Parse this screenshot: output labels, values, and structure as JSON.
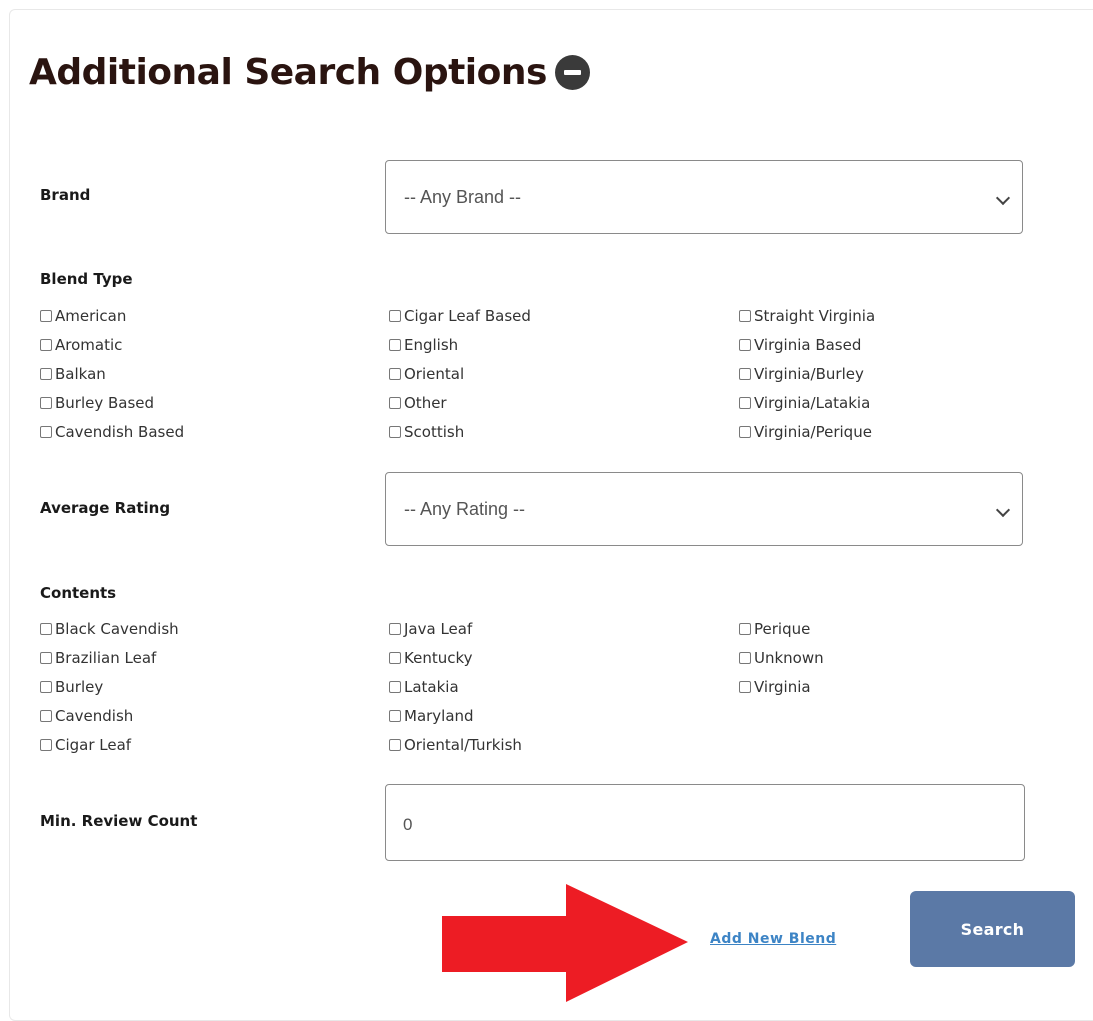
{
  "header": {
    "title": "Additional Search Options",
    "toggle_icon": "minus-circle-icon"
  },
  "brand": {
    "label": "Brand",
    "selected": "-- Any Brand --"
  },
  "blend_type": {
    "label": "Blend Type",
    "columns": [
      [
        "American",
        "Aromatic",
        "Balkan",
        "Burley Based",
        "Cavendish Based"
      ],
      [
        "Cigar Leaf Based",
        "English",
        "Oriental",
        "Other",
        "Scottish"
      ],
      [
        "Straight Virginia",
        "Virginia Based",
        "Virginia/Burley",
        "Virginia/Latakia",
        "Virginia/Perique"
      ]
    ]
  },
  "rating": {
    "label": "Average Rating",
    "selected": "-- Any Rating --"
  },
  "contents": {
    "label": "Contents",
    "columns": [
      [
        "Black Cavendish",
        "Brazilian Leaf",
        "Burley",
        "Cavendish",
        "Cigar Leaf"
      ],
      [
        "Java Leaf",
        "Kentucky",
        "Latakia",
        "Maryland",
        "Oriental/Turkish"
      ],
      [
        "Perique",
        "Unknown",
        "Virginia"
      ]
    ]
  },
  "review_count": {
    "label": "Min. Review Count",
    "value": "0"
  },
  "actions": {
    "add_link": "Add New Blend",
    "search_label": "Search"
  },
  "colors": {
    "title": "#2a1410",
    "search_button": "#5b79a6",
    "link": "#3d84c5",
    "arrow": "#ed1c24"
  }
}
